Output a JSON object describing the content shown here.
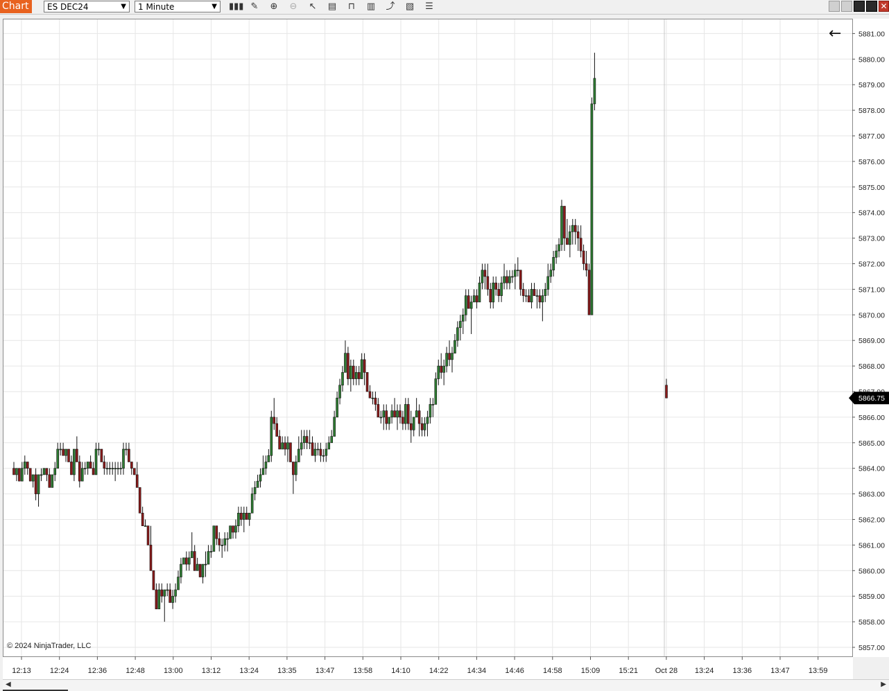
{
  "toolbar": {
    "tab_label": "Chart",
    "instrument": "ES DEC24",
    "interval": "1 Minute",
    "icons": [
      "bar-type-icon",
      "draw-pencil-icon",
      "zoom-in-icon",
      "zoom-out-icon",
      "pointer-icon",
      "data-box-icon",
      "indicator-icon",
      "strategy-icon",
      "trend-icon",
      "template-icon",
      "properties-icon"
    ]
  },
  "chart": {
    "copyright": "© 2024 NinjaTrader, LLC",
    "last_price_label": "5866.75",
    "back_glyph": "←"
  },
  "chart_data": {
    "type": "candlestick",
    "ytick_labels": [
      "5857.00",
      "5858.00",
      "5859.00",
      "5860.00",
      "5861.00",
      "5862.00",
      "5863.00",
      "5864.00",
      "5865.00",
      "5866.00",
      "5867.00",
      "5868.00",
      "5869.00",
      "5870.00",
      "5871.00",
      "5872.00",
      "5873.00",
      "5874.00",
      "5875.00",
      "5876.00",
      "5877.00",
      "5878.00",
      "5879.00",
      "5880.00",
      "5881.00"
    ],
    "xtick_labels": [
      "12:13",
      "12:24",
      "12:36",
      "12:48",
      "13:00",
      "13:12",
      "13:24",
      "13:35",
      "13:47",
      "13:58",
      "14:10",
      "14:22",
      "14:34",
      "14:46",
      "14:58",
      "15:09",
      "15:21",
      "Oct 28",
      "13:24",
      "13:36",
      "13:47",
      "13:59"
    ],
    "ylim": [
      5856.75,
      5881.5
    ],
    "last_price": 5866.75,
    "colors": {
      "up": "#2e7d32",
      "down": "#8b1a1a",
      "grid": "#e6e6e6"
    },
    "candles": [
      [
        5864.0,
        5864.25,
        5863.75,
        5863.75
      ],
      [
        5863.75,
        5864.0,
        5863.5,
        5864.0
      ],
      [
        5864.0,
        5864.0,
        5863.5,
        5863.5
      ],
      [
        5863.5,
        5864.25,
        5863.5,
        5864.0
      ],
      [
        5864.0,
        5864.5,
        5863.75,
        5864.25
      ],
      [
        5864.25,
        5864.25,
        5863.75,
        5864.0
      ],
      [
        5864.0,
        5864.0,
        5863.5,
        5863.5
      ],
      [
        5863.5,
        5863.75,
        5863.25,
        5863.75
      ],
      [
        5863.75,
        5864.0,
        5862.75,
        5863.0
      ],
      [
        5863.0,
        5863.75,
        5862.5,
        5863.75
      ],
      [
        5863.75,
        5864.0,
        5863.5,
        5863.75
      ],
      [
        5863.75,
        5864.0,
        5863.75,
        5864.0
      ],
      [
        5864.0,
        5864.0,
        5863.5,
        5863.75
      ],
      [
        5863.75,
        5864.0,
        5863.25,
        5863.25
      ],
      [
        5863.25,
        5863.75,
        5863.25,
        5863.75
      ],
      [
        5863.75,
        5864.25,
        5863.5,
        5864.0
      ],
      [
        5864.0,
        5865.0,
        5864.0,
        5864.75
      ],
      [
        5864.75,
        5865.0,
        5864.5,
        5864.75
      ],
      [
        5864.75,
        5865.0,
        5864.5,
        5864.5
      ],
      [
        5864.5,
        5864.75,
        5864.25,
        5864.75
      ],
      [
        5864.75,
        5864.75,
        5864.25,
        5864.25
      ],
      [
        5864.25,
        5864.5,
        5863.75,
        5863.75
      ],
      [
        5863.75,
        5864.75,
        5863.5,
        5864.75
      ],
      [
        5864.75,
        5865.25,
        5864.25,
        5864.25
      ],
      [
        5864.25,
        5864.5,
        5863.25,
        5863.5
      ],
      [
        5863.5,
        5864.25,
        5863.5,
        5864.0
      ],
      [
        5864.0,
        5864.25,
        5863.75,
        5864.0
      ],
      [
        5864.0,
        5864.25,
        5863.75,
        5864.25
      ],
      [
        5864.25,
        5864.5,
        5864.0,
        5864.0
      ],
      [
        5864.0,
        5864.25,
        5863.75,
        5863.75
      ],
      [
        5863.75,
        5865.0,
        5863.75,
        5864.75
      ],
      [
        5864.75,
        5865.0,
        5864.5,
        5864.75
      ],
      [
        5864.75,
        5864.75,
        5864.25,
        5864.25
      ],
      [
        5864.25,
        5864.5,
        5863.75,
        5864.0
      ],
      [
        5864.0,
        5864.25,
        5863.75,
        5864.0
      ],
      [
        5864.0,
        5864.25,
        5863.75,
        5864.0
      ],
      [
        5864.0,
        5864.25,
        5863.75,
        5864.0
      ],
      [
        5864.0,
        5864.25,
        5863.5,
        5864.0
      ],
      [
        5864.0,
        5864.25,
        5863.75,
        5864.0
      ],
      [
        5864.0,
        5864.25,
        5863.75,
        5864.0
      ],
      [
        5864.0,
        5865.0,
        5863.75,
        5864.75
      ],
      [
        5864.75,
        5865.0,
        5864.5,
        5864.75
      ],
      [
        5864.75,
        5865.0,
        5864.25,
        5864.25
      ],
      [
        5864.25,
        5864.25,
        5863.75,
        5864.0
      ],
      [
        5864.0,
        5864.0,
        5863.75,
        5863.75
      ],
      [
        5863.75,
        5864.25,
        5863.25,
        5863.25
      ],
      [
        5863.25,
        5863.25,
        5862.25,
        5862.25
      ],
      [
        5862.25,
        5862.5,
        5861.75,
        5861.75
      ],
      [
        5861.75,
        5862.0,
        5861.75,
        5861.75
      ],
      [
        5861.75,
        5861.75,
        5861.0,
        5861.0
      ],
      [
        5861.0,
        5861.75,
        5860.0,
        5860.0
      ],
      [
        5860.0,
        5860.0,
        5859.25,
        5859.25
      ],
      [
        5859.25,
        5859.5,
        5858.5,
        5858.5
      ],
      [
        5858.5,
        5859.5,
        5858.5,
        5859.25
      ],
      [
        5859.25,
        5859.5,
        5858.75,
        5859.0
      ],
      [
        5859.0,
        5859.25,
        5858.0,
        5859.25
      ],
      [
        5859.25,
        5859.5,
        5859.0,
        5859.25
      ],
      [
        5859.25,
        5859.5,
        5858.75,
        5858.75
      ],
      [
        5858.75,
        5859.25,
        5858.5,
        5859.0
      ],
      [
        5859.0,
        5859.5,
        5858.75,
        5859.25
      ],
      [
        5859.25,
        5860.0,
        5859.25,
        5859.75
      ],
      [
        5859.75,
        5860.5,
        5859.5,
        5860.25
      ],
      [
        5860.25,
        5860.5,
        5860.25,
        5860.5
      ],
      [
        5860.5,
        5860.75,
        5860.0,
        5860.25
      ],
      [
        5860.25,
        5860.75,
        5860.0,
        5860.5
      ],
      [
        5860.5,
        5861.5,
        5860.5,
        5860.75
      ],
      [
        5860.75,
        5861.0,
        5860.0,
        5860.0
      ],
      [
        5860.0,
        5860.5,
        5860.0,
        5860.25
      ],
      [
        5860.25,
        5860.25,
        5859.75,
        5859.75
      ],
      [
        5859.75,
        5860.25,
        5859.5,
        5860.25
      ],
      [
        5860.25,
        5860.75,
        5859.75,
        5860.25
      ],
      [
        5860.25,
        5861.0,
        5860.25,
        5860.75
      ],
      [
        5860.75,
        5861.0,
        5860.5,
        5860.75
      ],
      [
        5860.75,
        5861.75,
        5860.75,
        5861.75
      ],
      [
        5861.75,
        5861.75,
        5861.0,
        5861.25
      ],
      [
        5861.25,
        5861.5,
        5860.75,
        5861.0
      ],
      [
        5861.0,
        5861.25,
        5860.5,
        5861.0
      ],
      [
        5861.0,
        5861.5,
        5860.75,
        5861.25
      ],
      [
        5861.25,
        5861.5,
        5860.75,
        5861.25
      ],
      [
        5861.25,
        5861.75,
        5861.25,
        5861.75
      ],
      [
        5861.75,
        5861.75,
        5861.25,
        5861.5
      ],
      [
        5861.5,
        5862.0,
        5861.25,
        5861.75
      ],
      [
        5861.75,
        5862.5,
        5861.5,
        5862.25
      ],
      [
        5862.25,
        5862.5,
        5861.75,
        5862.0
      ],
      [
        5862.0,
        5862.5,
        5861.5,
        5862.25
      ],
      [
        5862.25,
        5862.5,
        5862.0,
        5862.0
      ],
      [
        5862.0,
        5862.25,
        5861.75,
        5862.25
      ],
      [
        5862.25,
        5863.25,
        5862.25,
        5863.0
      ],
      [
        5863.0,
        5863.5,
        5862.75,
        5863.25
      ],
      [
        5863.25,
        5863.75,
        5863.25,
        5863.5
      ],
      [
        5863.5,
        5864.0,
        5863.25,
        5863.75
      ],
      [
        5863.75,
        5864.5,
        5863.75,
        5864.0
      ],
      [
        5864.0,
        5864.5,
        5863.75,
        5864.25
      ],
      [
        5864.25,
        5864.75,
        5864.25,
        5864.5
      ],
      [
        5864.5,
        5866.25,
        5864.25,
        5866.0
      ],
      [
        5866.0,
        5866.75,
        5865.5,
        5865.75
      ],
      [
        5865.75,
        5866.0,
        5865.25,
        5865.25
      ],
      [
        5865.25,
        5865.5,
        5864.75,
        5864.75
      ],
      [
        5864.75,
        5865.25,
        5864.75,
        5865.0
      ],
      [
        5865.0,
        5865.25,
        5864.5,
        5864.75
      ],
      [
        5864.75,
        5865.25,
        5864.25,
        5865.0
      ],
      [
        5865.0,
        5865.0,
        5864.25,
        5864.25
      ],
      [
        5864.25,
        5864.25,
        5863.0,
        5863.75
      ],
      [
        5863.75,
        5864.5,
        5863.5,
        5864.25
      ],
      [
        5864.25,
        5865.25,
        5864.25,
        5864.75
      ],
      [
        5864.75,
        5865.5,
        5864.5,
        5865.0
      ],
      [
        5865.0,
        5865.5,
        5864.75,
        5865.25
      ],
      [
        5865.25,
        5865.5,
        5864.75,
        5865.0
      ],
      [
        5865.0,
        5865.5,
        5864.75,
        5865.0
      ],
      [
        5865.0,
        5865.25,
        5864.5,
        5864.5
      ],
      [
        5864.5,
        5865.0,
        5864.25,
        5864.75
      ],
      [
        5864.75,
        5865.0,
        5864.5,
        5864.75
      ],
      [
        5864.75,
        5865.0,
        5864.25,
        5864.5
      ],
      [
        5864.5,
        5864.75,
        5864.25,
        5864.5
      ],
      [
        5864.5,
        5865.0,
        5864.25,
        5864.75
      ],
      [
        5864.75,
        5865.25,
        5864.75,
        5865.0
      ],
      [
        5865.0,
        5865.5,
        5865.0,
        5865.25
      ],
      [
        5865.25,
        5866.25,
        5865.25,
        5866.0
      ],
      [
        5866.0,
        5867.0,
        5866.0,
        5866.75
      ],
      [
        5866.75,
        5867.5,
        5866.5,
        5867.25
      ],
      [
        5867.25,
        5868.0,
        5867.0,
        5867.75
      ],
      [
        5867.75,
        5869.0,
        5867.75,
        5868.5
      ],
      [
        5868.5,
        5868.75,
        5867.25,
        5867.5
      ],
      [
        5867.5,
        5868.25,
        5867.0,
        5868.0
      ],
      [
        5868.0,
        5868.25,
        5867.25,
        5867.5
      ],
      [
        5867.5,
        5868.0,
        5867.25,
        5867.75
      ],
      [
        5867.75,
        5868.0,
        5867.25,
        5867.5
      ],
      [
        5867.5,
        5868.5,
        5867.5,
        5868.25
      ],
      [
        5868.25,
        5868.5,
        5867.25,
        5867.75
      ],
      [
        5867.75,
        5867.75,
        5867.0,
        5867.0
      ],
      [
        5867.0,
        5867.25,
        5866.75,
        5866.75
      ],
      [
        5866.75,
        5867.0,
        5866.5,
        5866.75
      ],
      [
        5866.75,
        5867.0,
        5866.25,
        5866.5
      ],
      [
        5866.5,
        5866.75,
        5866.0,
        5866.0
      ],
      [
        5866.0,
        5866.25,
        5865.75,
        5866.0
      ],
      [
        5866.0,
        5866.5,
        5865.5,
        5866.25
      ],
      [
        5866.25,
        5866.5,
        5865.5,
        5865.75
      ],
      [
        5865.75,
        5866.0,
        5865.5,
        5866.0
      ],
      [
        5866.0,
        5866.5,
        5865.75,
        5866.25
      ],
      [
        5866.25,
        5866.75,
        5866.0,
        5866.0
      ],
      [
        5866.0,
        5866.5,
        5865.5,
        5866.25
      ],
      [
        5866.25,
        5866.5,
        5865.75,
        5866.0
      ],
      [
        5866.0,
        5866.25,
        5865.5,
        5865.75
      ],
      [
        5865.75,
        5866.75,
        5865.5,
        5866.5
      ],
      [
        5866.5,
        5866.75,
        5865.5,
        5865.75
      ],
      [
        5865.75,
        5866.25,
        5865.0,
        5865.5
      ],
      [
        5865.5,
        5866.0,
        5865.25,
        5866.0
      ],
      [
        5866.0,
        5866.75,
        5866.0,
        5866.25
      ],
      [
        5866.25,
        5866.5,
        5865.25,
        5865.75
      ],
      [
        5865.75,
        5866.0,
        5865.25,
        5865.5
      ],
      [
        5865.5,
        5866.0,
        5865.25,
        5865.75
      ],
      [
        5865.75,
        5866.25,
        5865.25,
        5866.0
      ],
      [
        5866.0,
        5866.75,
        5865.75,
        5866.5
      ],
      [
        5866.5,
        5866.75,
        5866.0,
        5866.5
      ],
      [
        5866.5,
        5867.75,
        5866.5,
        5867.5
      ],
      [
        5867.5,
        5868.25,
        5867.25,
        5868.0
      ],
      [
        5868.0,
        5868.5,
        5867.5,
        5867.75
      ],
      [
        5867.75,
        5868.25,
        5867.25,
        5868.0
      ],
      [
        5868.0,
        5868.75,
        5867.75,
        5868.5
      ],
      [
        5868.5,
        5869.0,
        5868.0,
        5868.25
      ],
      [
        5868.25,
        5868.75,
        5867.75,
        5868.5
      ],
      [
        5868.5,
        5869.25,
        5868.5,
        5869.0
      ],
      [
        5869.0,
        5869.75,
        5868.75,
        5869.5
      ],
      [
        5869.5,
        5870.0,
        5869.0,
        5869.75
      ],
      [
        5869.75,
        5870.25,
        5869.25,
        5870.0
      ],
      [
        5870.0,
        5871.0,
        5869.75,
        5870.75
      ],
      [
        5870.75,
        5871.0,
        5870.25,
        5870.25
      ],
      [
        5870.25,
        5870.75,
        5869.25,
        5870.5
      ],
      [
        5870.5,
        5871.0,
        5870.5,
        5870.75
      ],
      [
        5870.75,
        5871.0,
        5870.25,
        5870.5
      ],
      [
        5870.5,
        5871.5,
        5870.5,
        5871.25
      ],
      [
        5871.25,
        5872.0,
        5871.0,
        5871.75
      ],
      [
        5871.75,
        5872.0,
        5871.0,
        5871.5
      ],
      [
        5871.5,
        5872.0,
        5870.75,
        5871.0
      ],
      [
        5871.0,
        5871.25,
        5870.25,
        5870.5
      ],
      [
        5870.5,
        5871.5,
        5870.25,
        5871.25
      ],
      [
        5871.25,
        5871.5,
        5870.75,
        5871.0
      ],
      [
        5871.0,
        5871.25,
        5870.5,
        5870.75
      ],
      [
        5870.75,
        5871.5,
        5870.5,
        5871.25
      ],
      [
        5871.25,
        5872.0,
        5871.0,
        5871.5
      ],
      [
        5871.5,
        5871.75,
        5871.0,
        5871.25
      ],
      [
        5871.25,
        5871.75,
        5871.0,
        5871.5
      ],
      [
        5871.5,
        5871.75,
        5871.25,
        5871.5
      ],
      [
        5871.5,
        5872.0,
        5871.0,
        5871.75
      ],
      [
        5871.75,
        5872.25,
        5871.5,
        5871.75
      ],
      [
        5871.75,
        5871.75,
        5870.75,
        5871.0
      ],
      [
        5871.0,
        5871.25,
        5870.5,
        5870.75
      ],
      [
        5870.75,
        5871.0,
        5870.5,
        5870.75
      ],
      [
        5870.75,
        5871.0,
        5870.5,
        5870.5
      ],
      [
        5870.5,
        5871.25,
        5870.25,
        5871.0
      ],
      [
        5871.0,
        5871.25,
        5870.75,
        5870.75
      ],
      [
        5870.75,
        5871.0,
        5870.25,
        5870.75
      ],
      [
        5870.75,
        5871.0,
        5870.25,
        5870.5
      ],
      [
        5870.5,
        5871.0,
        5869.75,
        5870.75
      ],
      [
        5870.75,
        5871.25,
        5870.5,
        5871.0
      ],
      [
        5871.0,
        5872.0,
        5870.75,
        5871.5
      ],
      [
        5871.5,
        5872.0,
        5871.25,
        5871.75
      ],
      [
        5871.75,
        5872.5,
        5871.5,
        5872.25
      ],
      [
        5872.25,
        5872.75,
        5872.0,
        5872.5
      ],
      [
        5872.5,
        5873.0,
        5872.25,
        5872.75
      ],
      [
        5872.75,
        5874.5,
        5872.5,
        5874.25
      ],
      [
        5874.25,
        5874.25,
        5872.5,
        5873.0
      ],
      [
        5873.0,
        5873.75,
        5872.75,
        5872.75
      ],
      [
        5872.75,
        5873.5,
        5872.25,
        5873.25
      ],
      [
        5873.25,
        5873.75,
        5872.75,
        5873.5
      ],
      [
        5873.5,
        5873.75,
        5872.75,
        5873.25
      ],
      [
        5873.25,
        5873.5,
        5872.5,
        5873.0
      ],
      [
        5873.0,
        5873.5,
        5872.25,
        5872.5
      ],
      [
        5872.5,
        5872.75,
        5871.75,
        5872.0
      ],
      [
        5872.0,
        5872.5,
        5871.5,
        5871.75
      ],
      [
        5871.75,
        5872.0,
        5870.0,
        5870.0
      ],
      [
        5870.0,
        5878.5,
        5870.0,
        5878.25
      ],
      [
        5878.25,
        5880.25,
        5878.0,
        5879.25
      ],
      [
        5867.25,
        5867.5,
        5866.75,
        5866.75
      ]
    ]
  }
}
